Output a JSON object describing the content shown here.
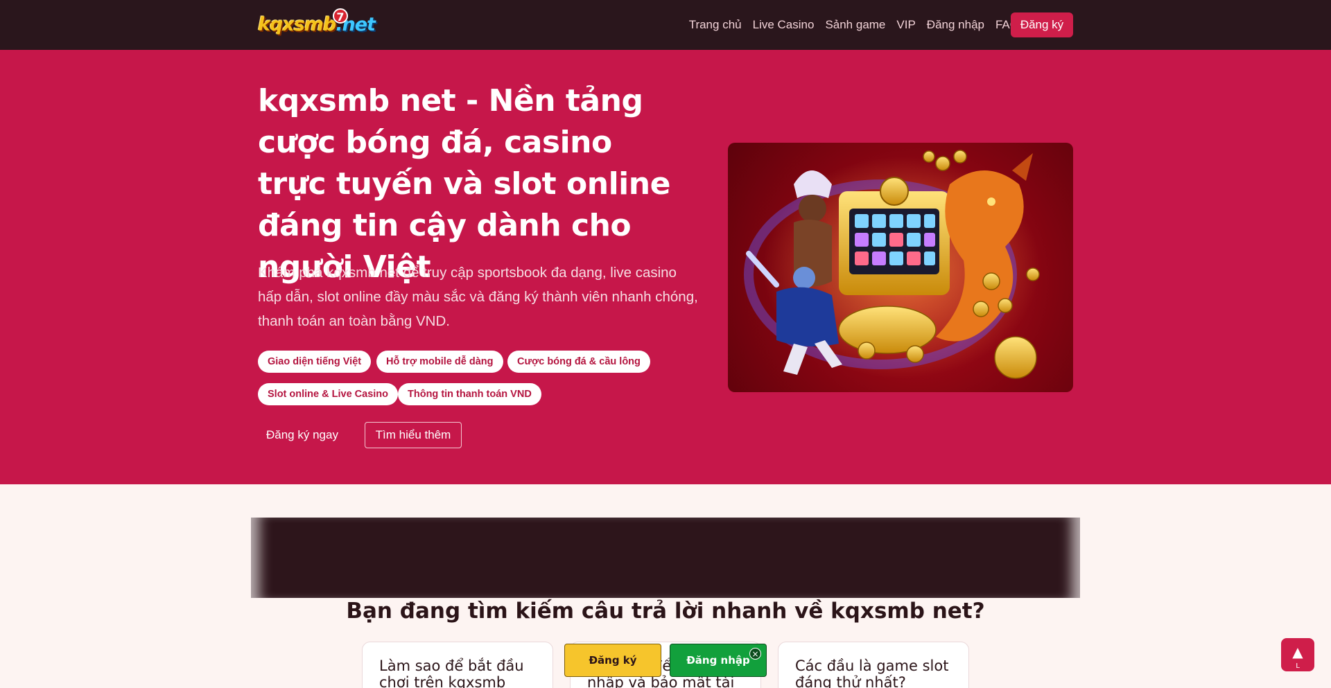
{
  "header": {
    "logo_main": "kqxsmb",
    "logo_suffix": ".net",
    "logo_badge": "7",
    "nav": [
      "Trang chủ",
      "Live Casino",
      "Sảnh game",
      "VIP",
      "Đăng nhập",
      "FAQ"
    ],
    "register_label": "Đăng ký"
  },
  "hero": {
    "title": "kqxsmb net - Nền tảng cược bóng đá, casino trực tuyến và slot online đáng tin cậy dành cho người Việt",
    "description": "Khám phá kqxsmb net để truy cập sportsbook đa dạng, live casino hấp dẫn, slot online đầy màu sắc và đăng ký thành viên nhanh chóng, thanh toán an toàn bằng VND.",
    "chips": [
      "Giao diện tiếng Việt",
      "Hỗ trợ mobile dễ dàng",
      "Cược bóng đá & cầu lông",
      "Slot online & Live Casino",
      "Thông tin thanh toán VND"
    ],
    "cta_primary": "Đăng ký ngay",
    "cta_secondary": "Tìm hiểu thêm"
  },
  "faq": {
    "title": "Bạn đang tìm kiếm câu trả lời nhanh về kqxsmb net?",
    "cards": [
      "Làm sao để bắt đầu chơi trên kqxsmb net?",
      "Làm sao để đăng nhập và bảo mật tài khoản?",
      "Các đầu là game slot đáng thử nhất?"
    ]
  },
  "floating_bar": {
    "register": "Đăng ký",
    "login": "Đăng nhập",
    "close": "×"
  },
  "back_to_top": {
    "arrow": "▲",
    "label": "L"
  },
  "colors": {
    "header_bg": "#2a161c",
    "hero_bg": "#c6174a",
    "accent": "#cf1e4a",
    "yellow": "#f6c52c",
    "green": "#12a03c"
  }
}
